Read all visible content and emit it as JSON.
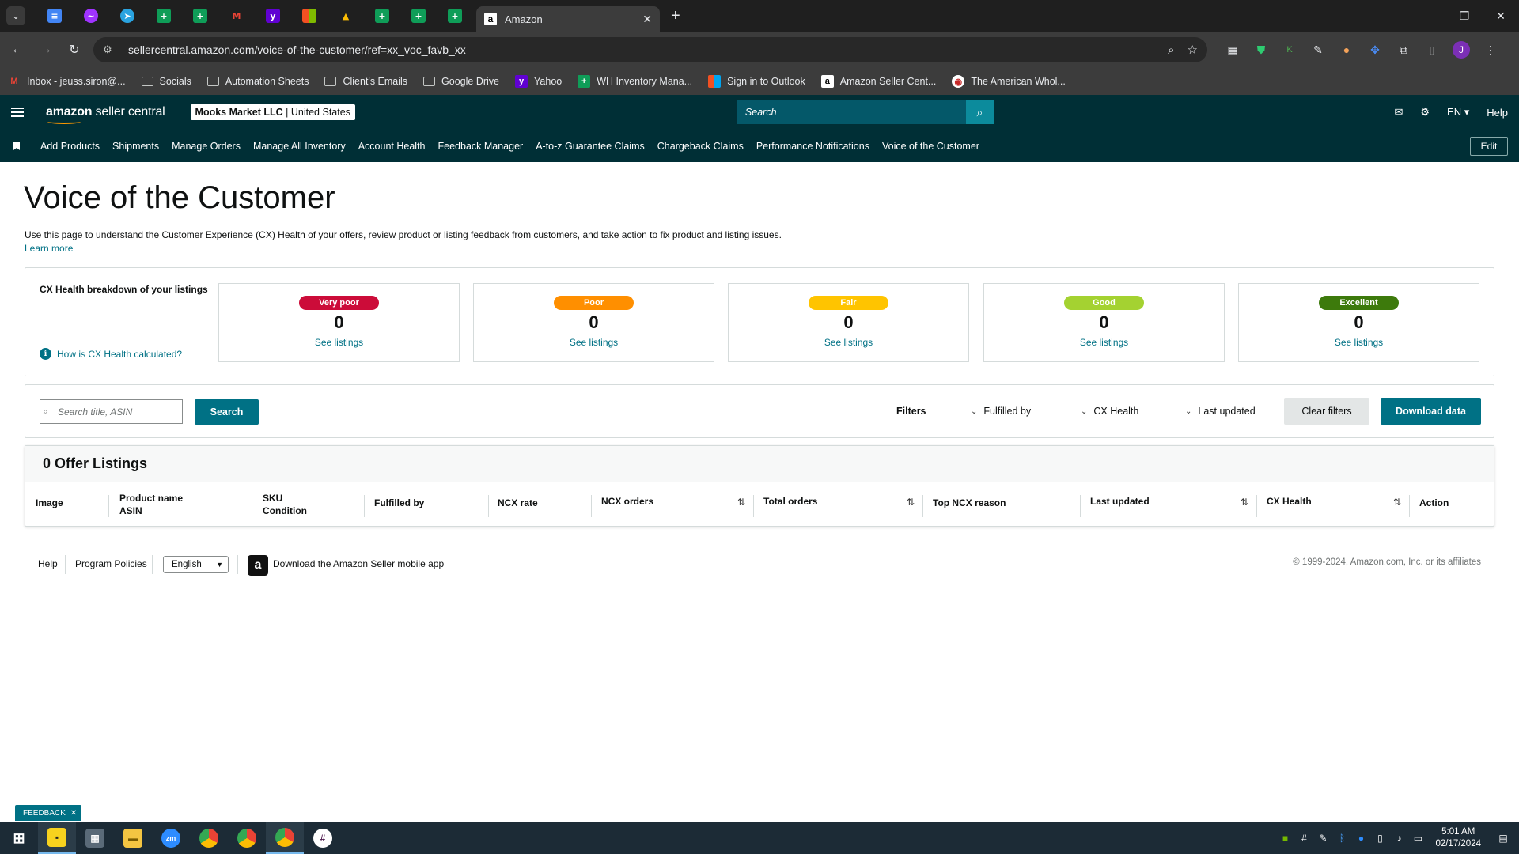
{
  "browser": {
    "active_tab_title": "Amazon",
    "url": "sellercentral.amazon.com/voice-of-the-customer/ref=xx_voc_favb_xx",
    "bookmarks": [
      {
        "label": "Inbox - jeuss.siron@...",
        "icon": "gmail-icon",
        "color": "#ea4335"
      },
      {
        "label": "Socials",
        "icon": "folder-icon"
      },
      {
        "label": "Automation Sheets",
        "icon": "folder-icon"
      },
      {
        "label": "Client's Emails",
        "icon": "folder-icon"
      },
      {
        "label": "Google Drive",
        "icon": "folder-icon"
      },
      {
        "label": "Yahoo",
        "icon": "yahoo-icon",
        "color": "#6001d2"
      },
      {
        "label": "WH Inventory Mana...",
        "icon": "sheets-icon",
        "color": "#0f9d58"
      },
      {
        "label": "Sign in to Outlook",
        "icon": "microsoft-icon",
        "color": "#f25022"
      },
      {
        "label": "Amazon Seller Cent...",
        "icon": "amazon-icon",
        "color": "#ffffff"
      },
      {
        "label": "The American Whol...",
        "icon": "store-icon",
        "color": "#c62828"
      }
    ]
  },
  "header": {
    "logo_bold": "amazon",
    "logo_rest": " seller central",
    "account_name": "Mooks Market LLC",
    "account_region": "United States",
    "search_placeholder": "Search",
    "language": "EN",
    "help": "Help"
  },
  "nav": {
    "links": [
      "Add Products",
      "Shipments",
      "Manage Orders",
      "Manage All Inventory",
      "Account Health",
      "Feedback Manager",
      "A-to-z Guarantee Claims",
      "Chargeback Claims",
      "Performance Notifications",
      "Voice of the Customer"
    ],
    "edit": "Edit"
  },
  "page": {
    "title": "Voice of the Customer",
    "intro": "Use this page to understand the Customer Experience (CX) Health of your offers, review product or listing feedback from customers, and take action to fix product and listing issues.",
    "learn_more": "Learn more"
  },
  "cx_health": {
    "label": "CX Health breakdown of your listings",
    "how_link": "How is CX Health calculated?",
    "cards": [
      {
        "label": "Very poor",
        "count": "0",
        "link": "See listings",
        "color": "#cc0c39",
        "text_color": "#ffffff"
      },
      {
        "label": "Poor",
        "count": "0",
        "link": "See listings",
        "color": "#ff8f00",
        "text_color": "#ffffff"
      },
      {
        "label": "Fair",
        "count": "0",
        "link": "See listings",
        "color": "#ffc400",
        "text_color": "#ffffff"
      },
      {
        "label": "Good",
        "count": "0",
        "link": "See listings",
        "color": "#a4d231",
        "text_color": "#ffffff"
      },
      {
        "label": "Excellent",
        "count": "0",
        "link": "See listings",
        "color": "#3d7a0c",
        "text_color": "#ffffff"
      }
    ]
  },
  "filters": {
    "search_placeholder": "Search title, ASIN",
    "search_button": "Search",
    "filters_label": "Filters",
    "fulfilled_by": "Fulfilled by",
    "cx_health": "CX Health",
    "last_updated": "Last updated",
    "clear": "Clear filters",
    "download": "Download data"
  },
  "listings": {
    "heading": "0 Offer Listings",
    "columns": {
      "image": "Image",
      "product_name": "Product name",
      "asin": "ASIN",
      "sku": "SKU",
      "condition": "Condition",
      "fulfilled_by": "Fulfilled by",
      "ncx_rate": "NCX rate",
      "ncx_orders": "NCX orders",
      "total_orders": "Total orders",
      "top_ncx_reason": "Top NCX reason",
      "last_updated": "Last updated",
      "cx_health": "CX Health",
      "action": "Action"
    }
  },
  "footer": {
    "help": "Help",
    "policies": "Program Policies",
    "language": "English",
    "app": "Download the Amazon Seller mobile app",
    "copyright": "© 1999-2024, Amazon.com, Inc. or its affiliates"
  },
  "feedback": "FEEDBACK",
  "taskbar": {
    "time": "5:01 AM",
    "date": "02/17/2024"
  }
}
